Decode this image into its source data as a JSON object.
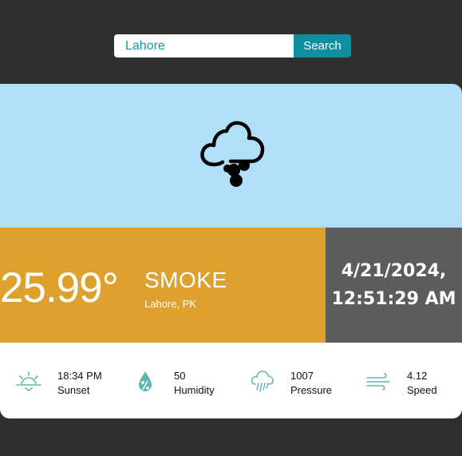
{
  "search": {
    "value": "Lahore",
    "button_label": "Search"
  },
  "current": {
    "icon": "smoke-cloud-icon",
    "temperature": "25.99°",
    "condition": "SMOKE",
    "location": "Lahore, PK",
    "date": "4/21/2024,",
    "time": "12:51:29 AM"
  },
  "stats": [
    {
      "icon": "sunset-icon",
      "value": "18:34 PM",
      "label": "Sunset"
    },
    {
      "icon": "humidity-icon",
      "value": "50",
      "label": "Humidity"
    },
    {
      "icon": "pressure-icon",
      "value": "1007",
      "label": "Pressure"
    },
    {
      "icon": "wind-icon",
      "value": "4.12",
      "label": "Speed"
    }
  ],
  "colors": {
    "background": "#2f2f2f",
    "accent": "#0e8f9f",
    "icon_panel": "#b1def8",
    "temp_panel": "#dea12e",
    "datetime_panel": "#5c5c5c",
    "stat_icon": "#5fb7ae"
  }
}
